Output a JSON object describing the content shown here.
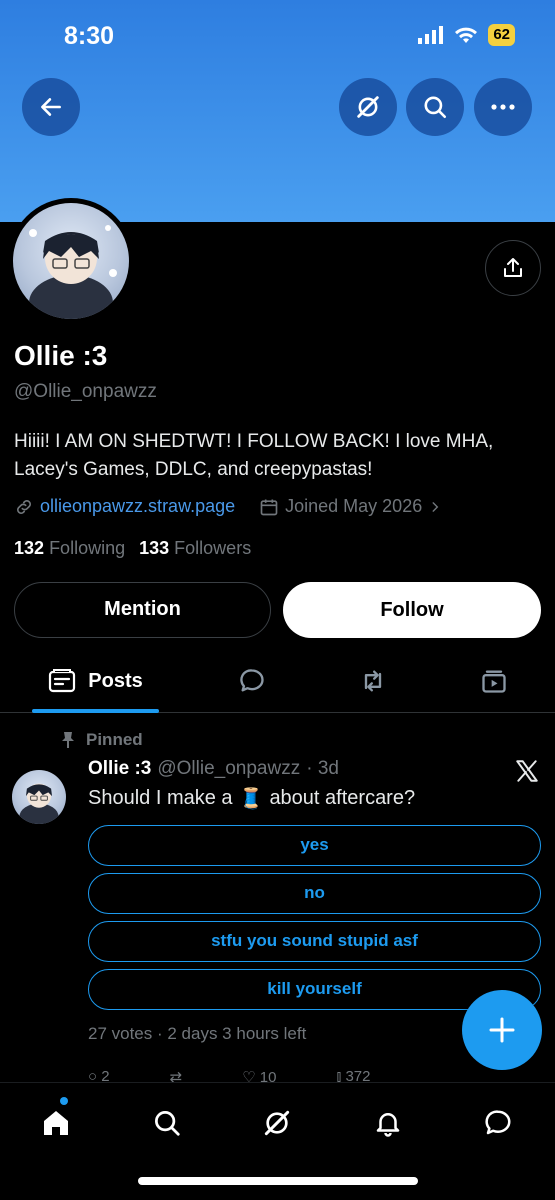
{
  "status_bar": {
    "time": "8:30",
    "battery": "62"
  },
  "profile": {
    "name": "Ollie :3",
    "handle": "@Ollie_onpawzz",
    "bio": "Hiiii! I AM ON SHEDTWT! I FOLLOW BACK! I love MHA, Lacey's Games, DDLC, and creepypastas!",
    "link": "ollieonpawzz.straw.page",
    "joined": "Joined May 2026",
    "following_count": "132",
    "following_label": "Following",
    "followers_count": "133",
    "followers_label": "Followers",
    "mention_label": "Mention",
    "follow_label": "Follow"
  },
  "tabs": {
    "posts_label": "Posts"
  },
  "pinned_post": {
    "pinned_label": "Pinned",
    "name": "Ollie :3",
    "handle": "@Ollie_onpawzz",
    "time": "· 3d",
    "text_before": "Should I make a",
    "emoji": "🧵",
    "text_after": "about aftercare?",
    "poll_options": [
      "yes",
      "no",
      "stfu you sound stupid asf",
      "kill yourself"
    ],
    "poll_meta": "27 votes · 2 days 3 hours left",
    "actions": {
      "replies": "2",
      "likes": "10",
      "views": "372"
    }
  },
  "colors": {
    "accent": "#1d9bf0",
    "banner": "#3b8ee8",
    "background": "#000000"
  },
  "icons": [
    "back-arrow-icon",
    "grok-icon",
    "search-icon",
    "more-icon",
    "share-icon",
    "link-icon",
    "calendar-icon",
    "chevron-right-icon",
    "posts-icon",
    "reply-icon",
    "repost-icon",
    "media-icon",
    "pin-icon",
    "x-logo-icon",
    "compose-plus-icon",
    "home-icon",
    "notifications-icon",
    "messages-icon"
  ]
}
